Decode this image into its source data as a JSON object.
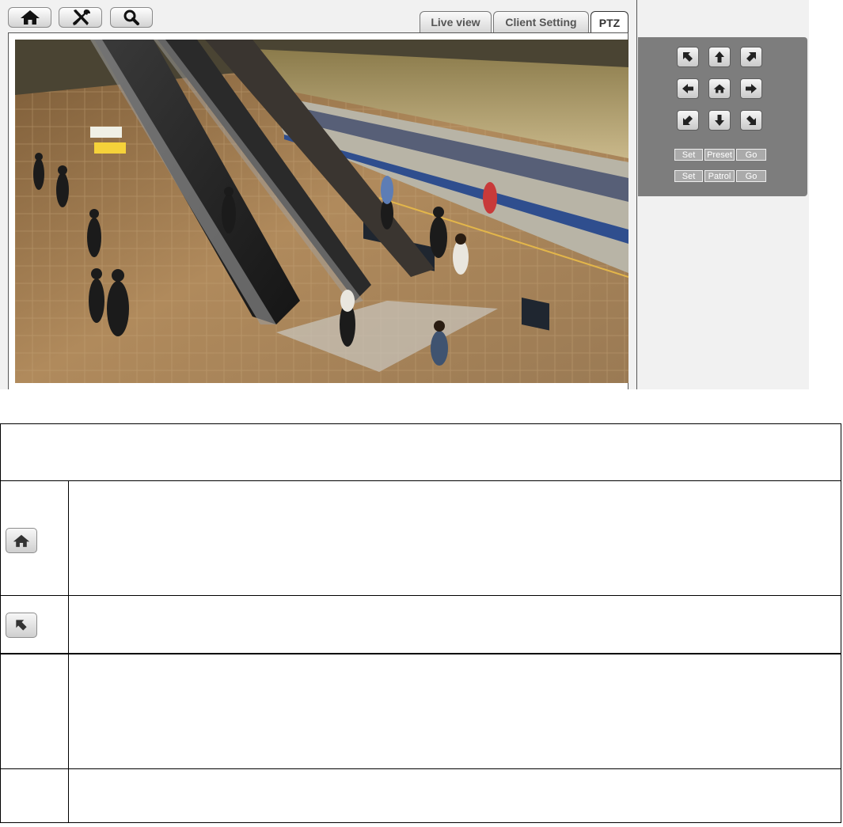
{
  "toolbar": {
    "buttons": [
      {
        "name": "home",
        "icon": "home-icon"
      },
      {
        "name": "settings",
        "icon": "tools-icon"
      },
      {
        "name": "search",
        "icon": "magnifier-icon"
      }
    ]
  },
  "tabs": [
    {
      "label": "Live view",
      "active": false
    },
    {
      "label": "Client Setting",
      "active": false
    },
    {
      "label": "PTZ",
      "active": true
    }
  ],
  "ptz": {
    "direction_icons": [
      "arrow-up-left-icon",
      "arrow-up-icon",
      "arrow-up-right-icon",
      "arrow-left-icon",
      "home-icon",
      "arrow-right-icon",
      "arrow-down-left-icon",
      "arrow-down-icon",
      "arrow-down-right-icon"
    ],
    "preset_row": {
      "set": "Set",
      "label": "Preset",
      "go": "Go"
    },
    "patrol_row": {
      "set": "Set",
      "label": "Patrol",
      "go": "Go"
    }
  },
  "colors": {
    "panel": "#7d7d7d",
    "background": "#f1f1f1",
    "small_button": "#aaaaaa"
  },
  "table": {
    "rows": [
      {
        "icon": "home-icon"
      },
      {
        "icon": "arrow-up-left-icon"
      },
      {
        "icon": null
      },
      {
        "icon": null
      }
    ]
  }
}
